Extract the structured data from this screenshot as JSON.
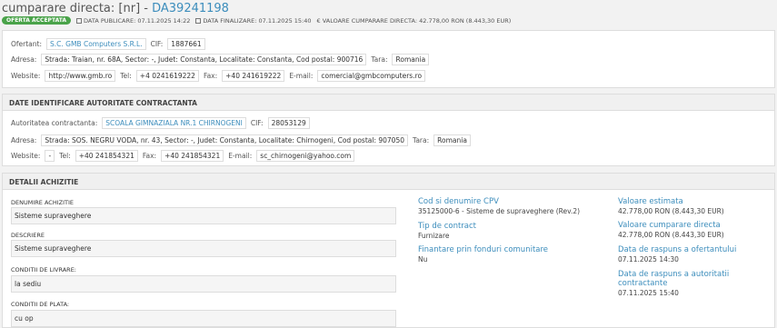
{
  "header": {
    "title_prefix": "cumparare directa: [nr] - ",
    "title_code": "DA39241198",
    "badge": "OFERTA ACCEPTATA",
    "data_publicare": "DATA PUBLICARE: 07.11.2025 14:22",
    "data_finalizare": "DATA FINALIZARE: 07.11.2025 15:40",
    "valoare": "€ VALOARE CUMPARARE DIRECTA: 42.778,00   RON (8.443,30   EUR)"
  },
  "ofertant": {
    "label": "Ofertant:",
    "name": "S.C. GMB Computers S.R.L.",
    "cif_label": "CIF:",
    "cif": "1887661",
    "adresa_label": "Adresa:",
    "adresa": "Strada: Traian, nr. 68A, Sector: -, Judet: Constanta, Localitate: Constanta, Cod postal: 900716",
    "tara_label": "Tara:",
    "tara": "Romania",
    "website_label": "Website:",
    "website": "http://www.gmb.ro",
    "tel_label": "Tel:",
    "tel": "+4 0241619222",
    "fax_label": "Fax:",
    "fax": "+40 241619222",
    "email_label": "E-mail:",
    "email": "comercial@gmbcomputers.ro"
  },
  "autoritate": {
    "section_title": "DATE IDENTIFICARE AUTORITATE CONTRACTANTA",
    "label": "Autoritatea contractanta:",
    "name": "SCOALA GIMNAZIALA NR.1 CHIRNOGENI",
    "cif_label": "CIF:",
    "cif": "28053129",
    "adresa_label": "Adresa:",
    "adresa": "Strada: SOS. NEGRU VODA, nr. 43, Sector: -, Judet: Constanta, Localitate: Chirnogeni, Cod postal: 907050",
    "tara_label": "Tara:",
    "tara": "Romania",
    "website_label": "Website:",
    "website": "-",
    "tel_label": "Tel:",
    "tel": "+40 241854321",
    "fax_label": "Fax:",
    "fax": "+40 241854321",
    "email_label": "E-mail:",
    "email": "sc_chirnogeni@yahoo.com"
  },
  "detalii": {
    "section_title": "DETALII ACHIZITIE",
    "denumire_label": "DENUMIRE ACHIZITIE",
    "denumire": "Sisteme supraveghere",
    "descriere_label": "DESCRIERE",
    "descriere": "Sisteme supraveghere",
    "livrare_label": "CONDITII DE LIVRARE:",
    "livrare": "la sediu",
    "plata_label": "CONDITII DE PLATA:",
    "plata": "cu op",
    "cpv_title": "Cod si denumire CPV",
    "cpv": "35125000-6 - Sisteme de supraveghere (Rev.2)",
    "tip_title": "Tip de contract",
    "tip": "Furnizare",
    "fonduri_title": "Finantare prin fonduri comunitare",
    "fonduri": "Nu",
    "val_est_title": "Valoare estimata",
    "val_est": "42.778,00   RON (8.443,30   EUR)",
    "val_cump_title": "Valoare cumparare directa",
    "val_cump": "42.778,00   RON (8.443,30   EUR)",
    "raspuns_of_title": "Data de raspuns a ofertantului",
    "raspuns_of": "07.11.2025 14:30",
    "raspuns_aut_title": "Data de raspuns a autoritatii contractante",
    "raspuns_aut": "07.11.2025 15:40"
  }
}
